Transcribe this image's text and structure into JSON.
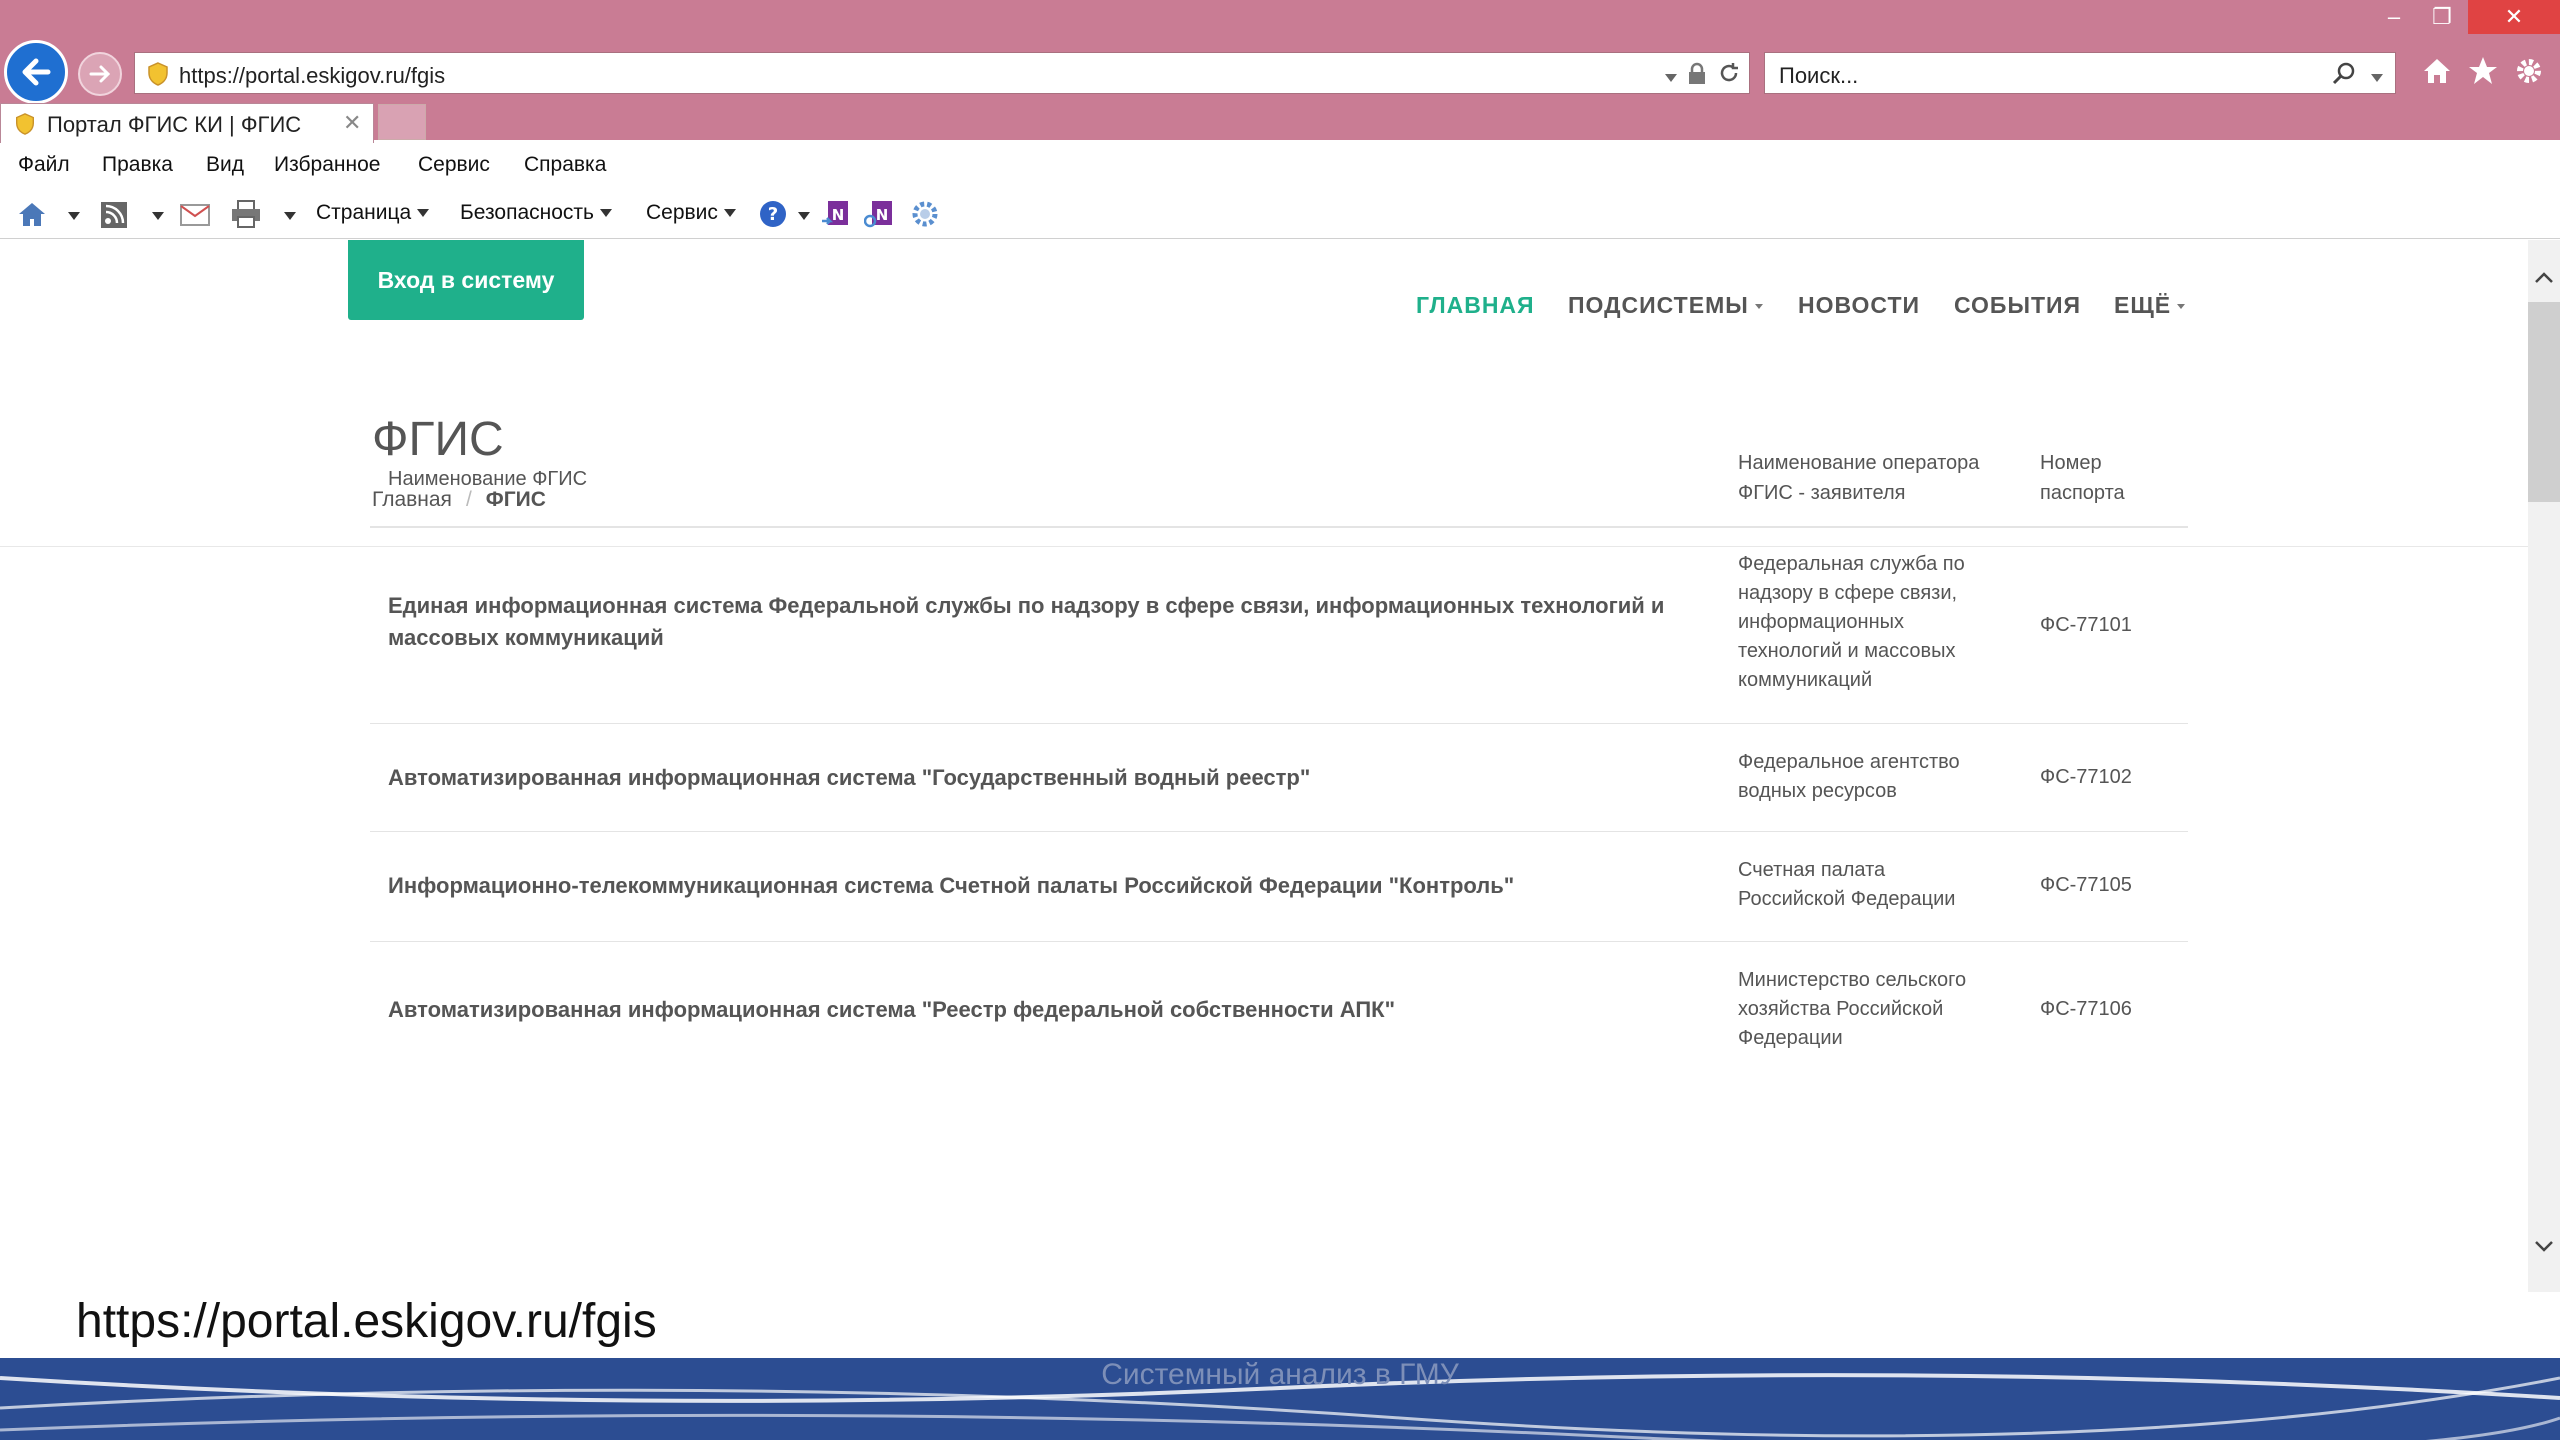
{
  "browser": {
    "url": "https://portal.eskigov.ru/fgis",
    "search_placeholder": "Поиск...",
    "tab_title": "Портал ФГИС КИ | ФГИС",
    "menu": [
      "Файл",
      "Правка",
      "Вид",
      "Избранное",
      "Сервис",
      "Справка"
    ],
    "commands": {
      "page": "Страница",
      "security": "Безопасность",
      "service": "Сервис"
    }
  },
  "site": {
    "login_label": "Вход в систему",
    "nav": [
      "ГЛАВНАЯ",
      "ПОДСИСТЕМЫ",
      "НОВОСТИ",
      "СОБЫТИЯ",
      "ЕЩЁ"
    ],
    "accent_color": "#1fb08b"
  },
  "page": {
    "title": "ФГИС",
    "breadcrumb": {
      "home": "Главная",
      "sep": "/",
      "current": "ФГИС"
    }
  },
  "table": {
    "headers": {
      "name": "Наименование ФГИС",
      "operator_line1": "Наименование оператора",
      "operator_line2": "ФГИС - заявителя",
      "passport_line1": "Номер",
      "passport_line2": "паспорта"
    },
    "rows": [
      {
        "name_line1": "Единая информационная система Федеральной службы по надзору в сфере связи, информационных технологий и",
        "name_line2": "массовых коммуникаций",
        "op": [
          "Федеральная служба по",
          "надзору в сфере связи,",
          "информационных",
          "технологий и массовых",
          "коммуникаций"
        ],
        "num": "ФС-77101"
      },
      {
        "name_line1": "Автоматизированная информационная система \"Государственный водный реестр\"",
        "op": [
          "Федеральное агентство",
          "водных ресурсов"
        ],
        "num": "ФС-77102"
      },
      {
        "name_line1": "Информационно-телекоммуникационная система Счетной палаты Российской Федерации \"Контроль\"",
        "op": [
          "Счетная палата",
          "Российской Федерации"
        ],
        "num": "ФС-77105"
      },
      {
        "name_line1": "Автоматизированная информационная система \"Реестр федеральной собственности АПК\"",
        "op": [
          "Министерство сельского",
          "хозяйства Российской",
          "Федерации"
        ],
        "num": "ФС-77106"
      }
    ]
  },
  "slide": {
    "url_caption": "https://portal.eskigov.ru/fgis",
    "footer": "Системный анализ в ГМУ"
  }
}
